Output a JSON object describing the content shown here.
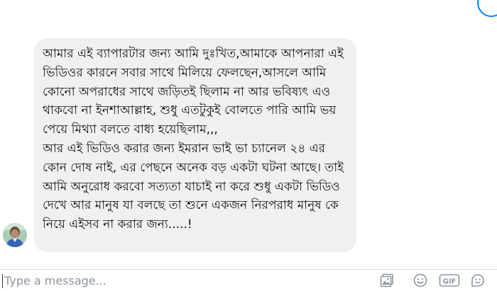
{
  "conversation": {
    "message": {
      "lines": [
        "আমার এই ব্যাপারটার জন্য আমি দুঃখিত,আমাকে আপনারা এই",
        "ভিডিওর কারনে সবার সাথে মিলিয়ে ফেলছেন,আসলে আমি",
        "কোনো অপরাধের সাথে জড়িতই ছিলাম না আর ভবিষ্যৎ এও",
        "থাকবো না ইনশাআল্লাহ, শুধু এতটুকুই বোলতে পারি আমি ভয়",
        "পেয়ে মিথ্যা বলতে বাধ্য হয়েছিলাম,,,",
        "আর এই ভিডিও করার জন্য ইমরান ভাই ভা চ্যানেল ২৪ এর",
        "কোন দোষ নাই, এর পেছনে অনেক বড় একটা ঘটনা আছে। তাই",
        "আমি অনুরোধ করবো সত্যতা যাচাই না করে শুধু একটা ভিডিও",
        "দেখে আর মানুষ যা বলছে তা শুনে একজন নিরপরাধ মানুষ কে",
        "নিয়ে এইসব না করার জন্য.....!"
      ]
    }
  },
  "composer": {
    "placeholder": "Type a message...",
    "value": "",
    "tools": [
      "photo-icon",
      "emoji-icon",
      "gif-icon",
      "sticker-icon"
    ]
  },
  "colors": {
    "bubble_bg": "#f1f0f0",
    "text": "#111111",
    "icon": "#8d949e",
    "accent": "#0084ff"
  }
}
